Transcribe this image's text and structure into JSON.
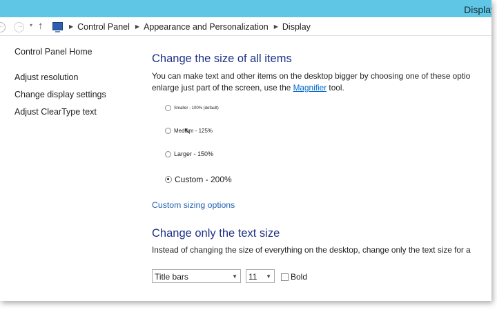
{
  "window": {
    "title": "Display"
  },
  "address_bar": {
    "breadcrumbs": [
      "Control Panel",
      "Appearance and Personalization",
      "Display"
    ]
  },
  "sidebar": {
    "home": "Control Panel Home",
    "links": [
      "Adjust resolution",
      "Change display settings",
      "Adjust ClearType text"
    ]
  },
  "main": {
    "heading": "Change the size of all items",
    "description_line1": "You can make text and other items on the desktop bigger by choosing one of these optio",
    "description_line2_pre": "enlarge just part of the screen, use the ",
    "magnifier_link": "Magnifier",
    "description_line2_post": " tool.",
    "options": [
      {
        "label": "Smaller - 100% (default)",
        "checked": false
      },
      {
        "label": "Medium - 125%",
        "checked": false
      },
      {
        "label": "Larger - 150%",
        "checked": false
      },
      {
        "label": "Custom - 200%",
        "checked": true
      }
    ],
    "custom_sizing_link": "Custom sizing options",
    "text_heading": "Change only the text size",
    "text_description": "Instead of changing the size of everything on the desktop, change only the text size for a",
    "element_select": "Title bars",
    "size_select": "11",
    "bold_label": "Bold"
  }
}
